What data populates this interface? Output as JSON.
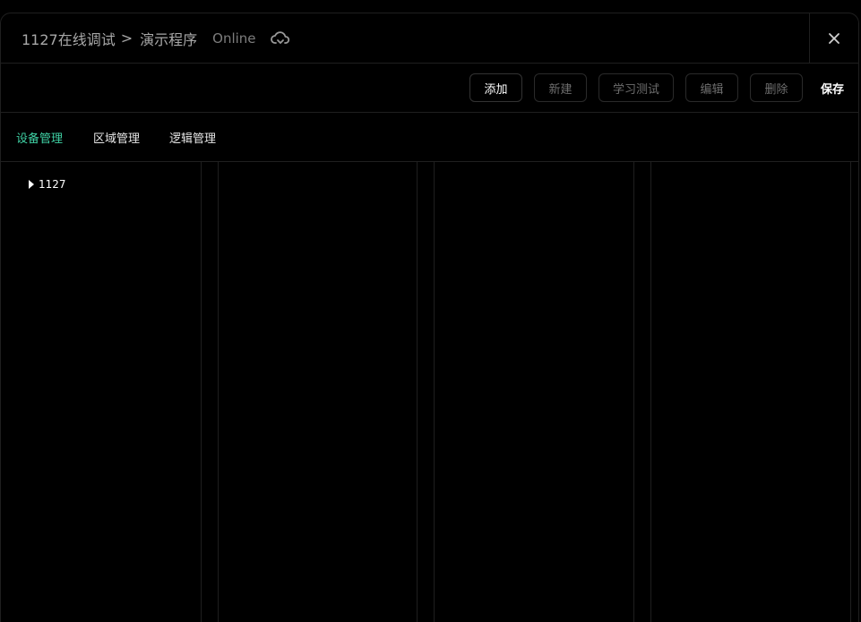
{
  "header": {
    "breadcrumb_root": "1127在线调试",
    "breadcrumb_separator": ">",
    "breadcrumb_current": "演示程序",
    "status": "Online",
    "cloud_icon": "cloud-sync-icon",
    "close_icon": "close-icon"
  },
  "toolbar": {
    "add_label": "添加",
    "new_label": "新建",
    "learn_test_label": "学习测试",
    "edit_label": "编辑",
    "delete_label": "删除",
    "save_label": "保存"
  },
  "tabs": [
    {
      "label": "设备管理",
      "active": true
    },
    {
      "label": "区域管理",
      "active": false
    },
    {
      "label": "逻辑管理",
      "active": false
    }
  ],
  "tree": {
    "items": [
      {
        "label": "1127",
        "expanded": false
      }
    ]
  },
  "colors": {
    "accent": "#3fd1a4",
    "background": "#000000",
    "border": "#1f1f1f"
  }
}
